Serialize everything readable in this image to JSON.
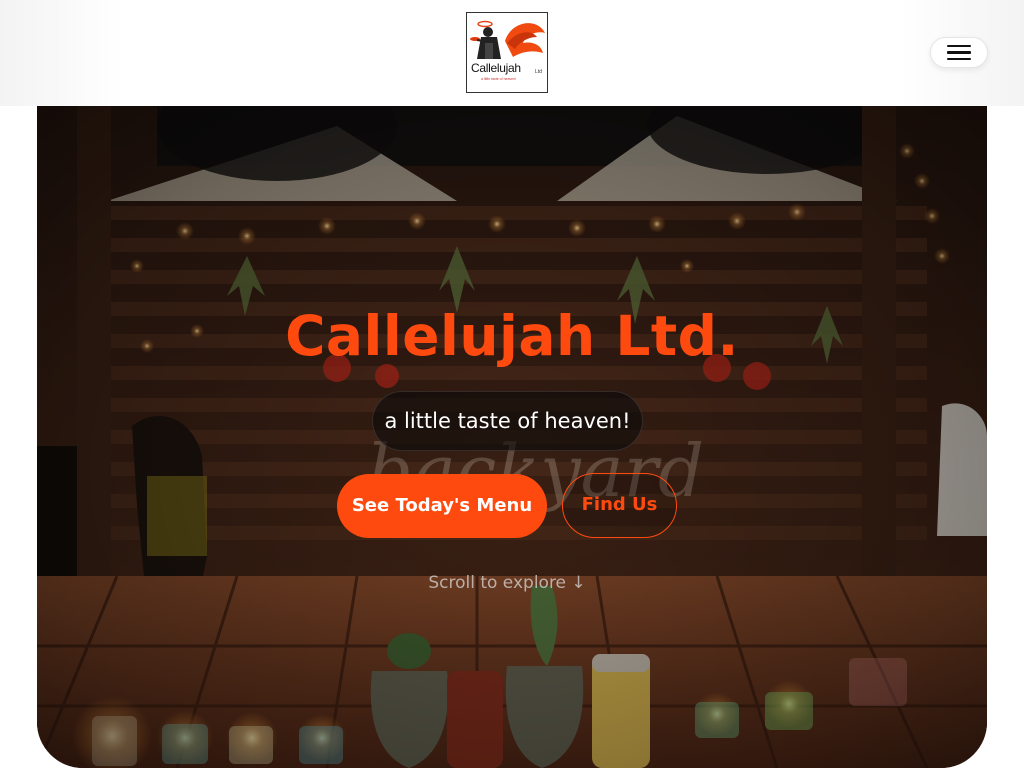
{
  "header": {
    "logo": {
      "name": "Callelujah",
      "suffix": "Ltd",
      "tagline": "a little taste of heaven!"
    },
    "menu_icon": "hamburger-menu-icon"
  },
  "hero": {
    "title": "Callelujah Ltd.",
    "tagline": "a little taste of heaven!",
    "primary_button": "See Today's Menu",
    "secondary_button": "Find Us",
    "scroll_hint": "Scroll to explore ↓"
  },
  "colors": {
    "accent": "#ff4a0f",
    "hero_background": "#1d120c",
    "header_background": "#ffffff"
  }
}
